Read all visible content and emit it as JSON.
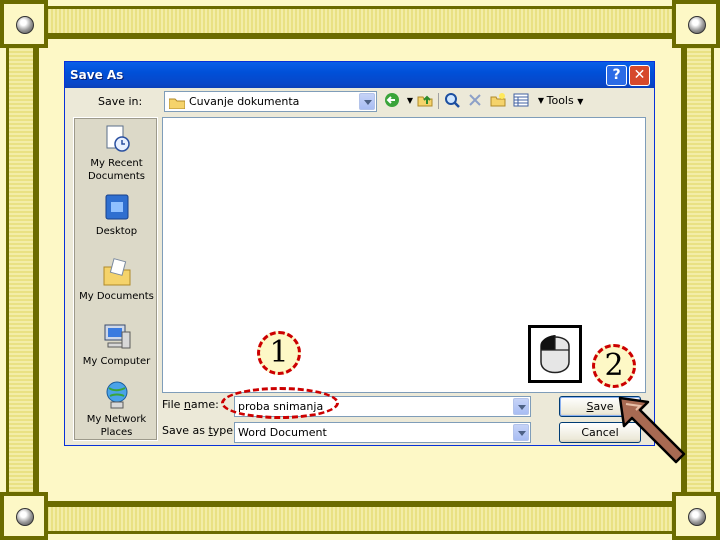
{
  "dialog": {
    "title": "Save As",
    "help_button": "?",
    "close_button": "✕",
    "save_in_label": "Save in:",
    "save_in_value": "Cuvanje dokumenta",
    "tools_label": "Tools",
    "places": [
      {
        "line1": "My Recent",
        "line2": "Documents",
        "icon": "recent-documents-icon"
      },
      {
        "line1": "Desktop",
        "line2": "",
        "icon": "desktop-icon"
      },
      {
        "line1": "My Documents",
        "line2": "",
        "icon": "my-documents-icon"
      },
      {
        "line1": "My Computer",
        "line2": "",
        "icon": "my-computer-icon"
      },
      {
        "line1": "My Network",
        "line2": "Places",
        "icon": "network-places-icon"
      }
    ],
    "file_name_label_pre": "File ",
    "file_name_label_acc": "n",
    "file_name_label_post": "ame:",
    "file_name_value": "proba snimanja",
    "save_type_label_pre": "Save as ",
    "save_type_label_acc": "t",
    "save_type_label_post": "ype:",
    "save_type_value": "Word Document",
    "save_button_acc": "S",
    "save_button_rest": "ave",
    "cancel_button": "Cancel"
  },
  "annotations": {
    "step1": "1",
    "step2": "2"
  },
  "colors": {
    "titlebar": "#0a5fe8",
    "highlight": "#cc0000",
    "frame": "#6b6b00",
    "background": "#fdf8c6"
  }
}
